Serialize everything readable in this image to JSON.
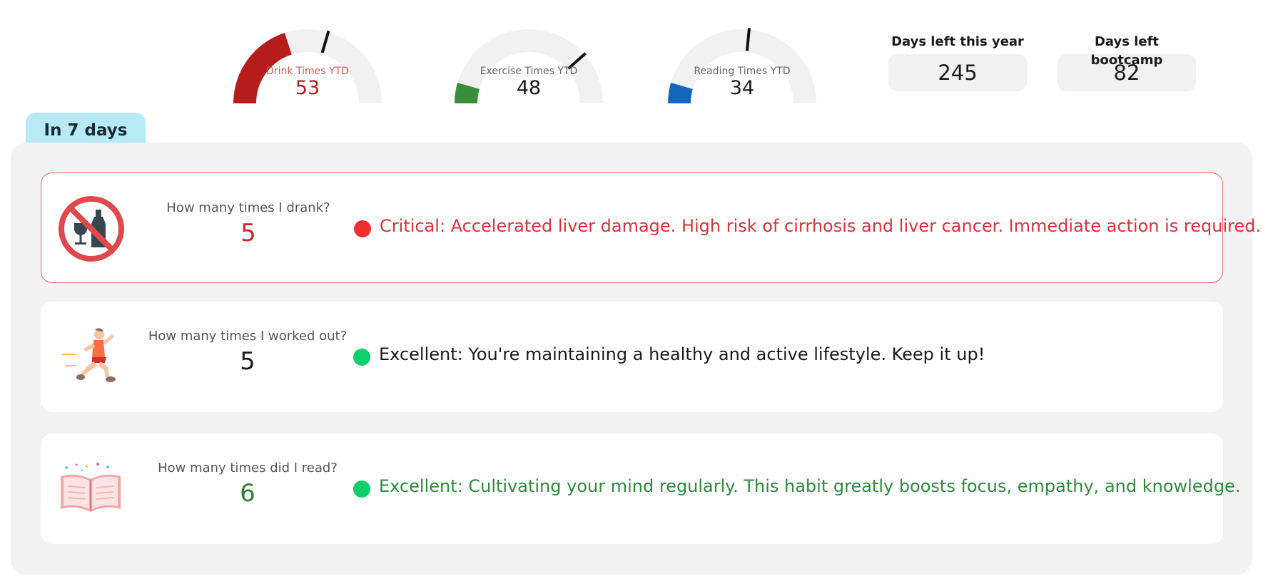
{
  "gauges": [
    {
      "label": "Drink Times YTD",
      "value": "53",
      "fill_fraction": 0.4,
      "needle_fraction": 0.59,
      "color": "#b71c1c",
      "label_color": "#d05a5a",
      "value_color": "#b71c1c"
    },
    {
      "label": "Exercise Times YTD",
      "value": "48",
      "fill_fraction": 0.09,
      "needle_fraction": 0.77,
      "color": "#388e3c",
      "label_color": "#666666",
      "value_color": "#1a1a1a"
    },
    {
      "label": "Reading Times YTD",
      "value": "34",
      "fill_fraction": 0.09,
      "needle_fraction": 0.53,
      "color": "#1565c0",
      "label_color": "#666666",
      "value_color": "#1a1a1a"
    }
  ],
  "counters": [
    {
      "title": "Days left this year",
      "value": "245"
    },
    {
      "title": "Days left bootcamp",
      "value": "82"
    }
  ],
  "section": {
    "tab_label": "In 7 days"
  },
  "cards": [
    {
      "icon": "no-drinking-icon",
      "question": "How many times I drank?",
      "value": "5",
      "value_color": "#c62828",
      "status_color": "#f03030",
      "message": "Critical: Accelerated liver damage. High risk of cirrhosis and liver cancer. Immediate action is required.",
      "message_color": "#d9343a"
    },
    {
      "icon": "running-person-icon",
      "question": "How many times I worked out?",
      "value": "5",
      "value_color": "#1a1a1a",
      "status_color": "#0fcf6a",
      "message": "Excellent: You're maintaining a healthy and active lifestyle. Keep it up!",
      "message_color": "#1a1a1a"
    },
    {
      "icon": "open-book-icon",
      "question": "How many times did I read?",
      "value": "6",
      "value_color": "#2e7d32",
      "status_color": "#0fcf6a",
      "message": "Excellent: Cultivating your mind regularly. This habit greatly boosts focus, empathy, and knowledge.",
      "message_color": "#2e8b3a"
    }
  ]
}
